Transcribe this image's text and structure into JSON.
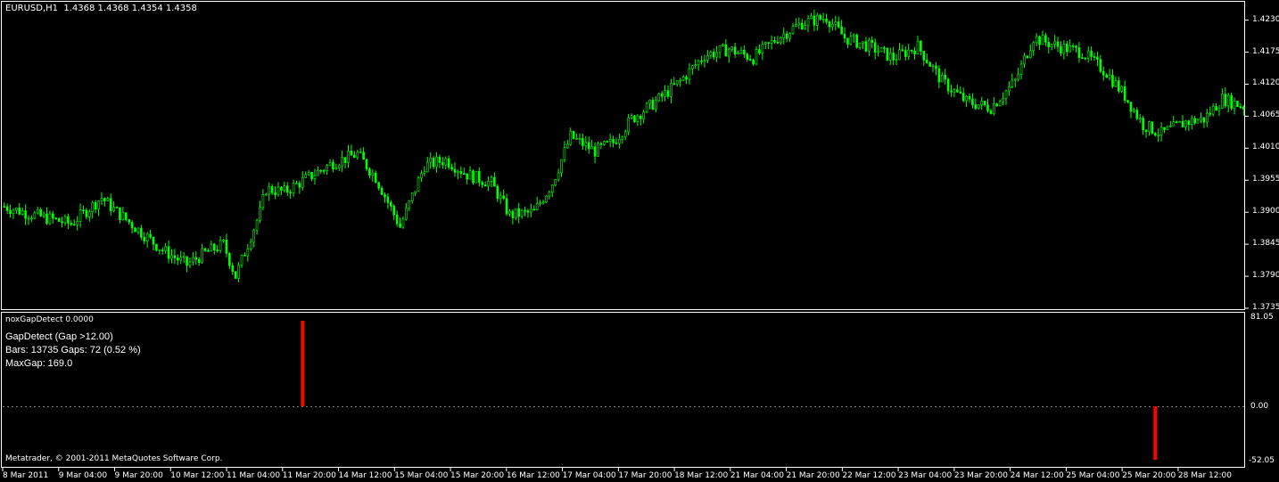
{
  "header": {
    "symbol": "EURUSD,H1",
    "ohlc": "1.4368 1.4368 1.4354 1.4358"
  },
  "indicator": {
    "title": "noxGapDetect 0.0000",
    "line1": "GapDetect (Gap >12.00)",
    "line2": "Bars: 13735   Gaps: 72   (0.52 %)",
    "line3": "MaxGap: 169.0",
    "scale_top": "81.05",
    "scale_zero": "0.00",
    "scale_bottom": "-52.05"
  },
  "footer": {
    "copyright": "Metatrader, © 2001-2011 MetaQuotes Software Corp."
  },
  "price_axis": [
    "1.4230",
    "1.4175",
    "1.4120",
    "1.4065",
    "1.4010",
    "1.3955",
    "1.3900",
    "1.3845",
    "1.3790",
    "1.3735"
  ],
  "time_axis": [
    "8 Mar 2011",
    "9 Mar 04:00",
    "9 Mar 20:00",
    "10 Mar 12:00",
    "11 Mar 04:00",
    "11 Mar 20:00",
    "14 Mar 12:00",
    "15 Mar 04:00",
    "15 Mar 20:00",
    "16 Mar 12:00",
    "17 Mar 04:00",
    "17 Mar 20:00",
    "18 Mar 12:00",
    "21 Mar 04:00",
    "21 Mar 20:00",
    "22 Mar 12:00",
    "23 Mar 04:00",
    "23 Mar 20:00",
    "24 Mar 12:00",
    "25 Mar 04:00",
    "25 Mar 20:00",
    "28 Mar 12:00"
  ],
  "colors": {
    "background": "#000000",
    "candle": "#00ff00",
    "gap_bar": "#ff0000",
    "frame": "#ffffff",
    "zero_line": "#808080"
  },
  "chart_data": {
    "type": "candlestick",
    "symbol": "EURUSD",
    "timeframe": "H1",
    "ylim": [
      1.3735,
      1.426
    ],
    "close_path": [
      [
        0,
        1.391
      ],
      [
        10,
        1.3895
      ],
      [
        22,
        1.388
      ],
      [
        32,
        1.3925
      ],
      [
        36,
        1.3905
      ],
      [
        44,
        1.387
      ],
      [
        52,
        1.3835
      ],
      [
        60,
        1.381
      ],
      [
        66,
        1.383
      ],
      [
        72,
        1.3845
      ],
      [
        76,
        1.379
      ],
      [
        84,
        1.39
      ],
      [
        86,
        1.394
      ],
      [
        92,
        1.3935
      ],
      [
        100,
        1.396
      ],
      [
        108,
        1.3985
      ],
      [
        116,
        1.4
      ],
      [
        122,
        1.396
      ],
      [
        130,
        1.3875
      ],
      [
        138,
        1.398
      ],
      [
        145,
        1.399
      ],
      [
        152,
        1.3965
      ],
      [
        160,
        1.395
      ],
      [
        166,
        1.3895
      ],
      [
        174,
        1.39
      ],
      [
        180,
        1.395
      ],
      [
        186,
        1.403
      ],
      [
        194,
        1.4005
      ],
      [
        200,
        1.402
      ],
      [
        206,
        1.406
      ],
      [
        214,
        1.409
      ],
      [
        222,
        1.4125
      ],
      [
        230,
        1.417
      ],
      [
        238,
        1.418
      ],
      [
        246,
        1.4165
      ],
      [
        254,
        1.42
      ],
      [
        262,
        1.4225
      ],
      [
        270,
        1.4235
      ],
      [
        276,
        1.42
      ],
      [
        284,
        1.4185
      ],
      [
        292,
        1.4165
      ],
      [
        300,
        1.4185
      ],
      [
        308,
        1.4125
      ],
      [
        316,
        1.409
      ],
      [
        324,
        1.408
      ],
      [
        332,
        1.4125
      ],
      [
        338,
        1.42
      ],
      [
        346,
        1.4185
      ],
      [
        354,
        1.4175
      ],
      [
        362,
        1.414
      ],
      [
        368,
        1.41
      ],
      [
        374,
        1.405
      ],
      [
        380,
        1.4035
      ],
      [
        388,
        1.4055
      ],
      [
        394,
        1.406
      ],
      [
        400,
        1.4095
      ],
      [
        408,
        1.408
      ]
    ],
    "bar_count": 408,
    "gaps": [
      {
        "bar": 98,
        "value": 81.05
      },
      {
        "bar": 378,
        "value": -52.05
      }
    ],
    "indicator_ylim": [
      -52.05,
      81.05
    ]
  }
}
